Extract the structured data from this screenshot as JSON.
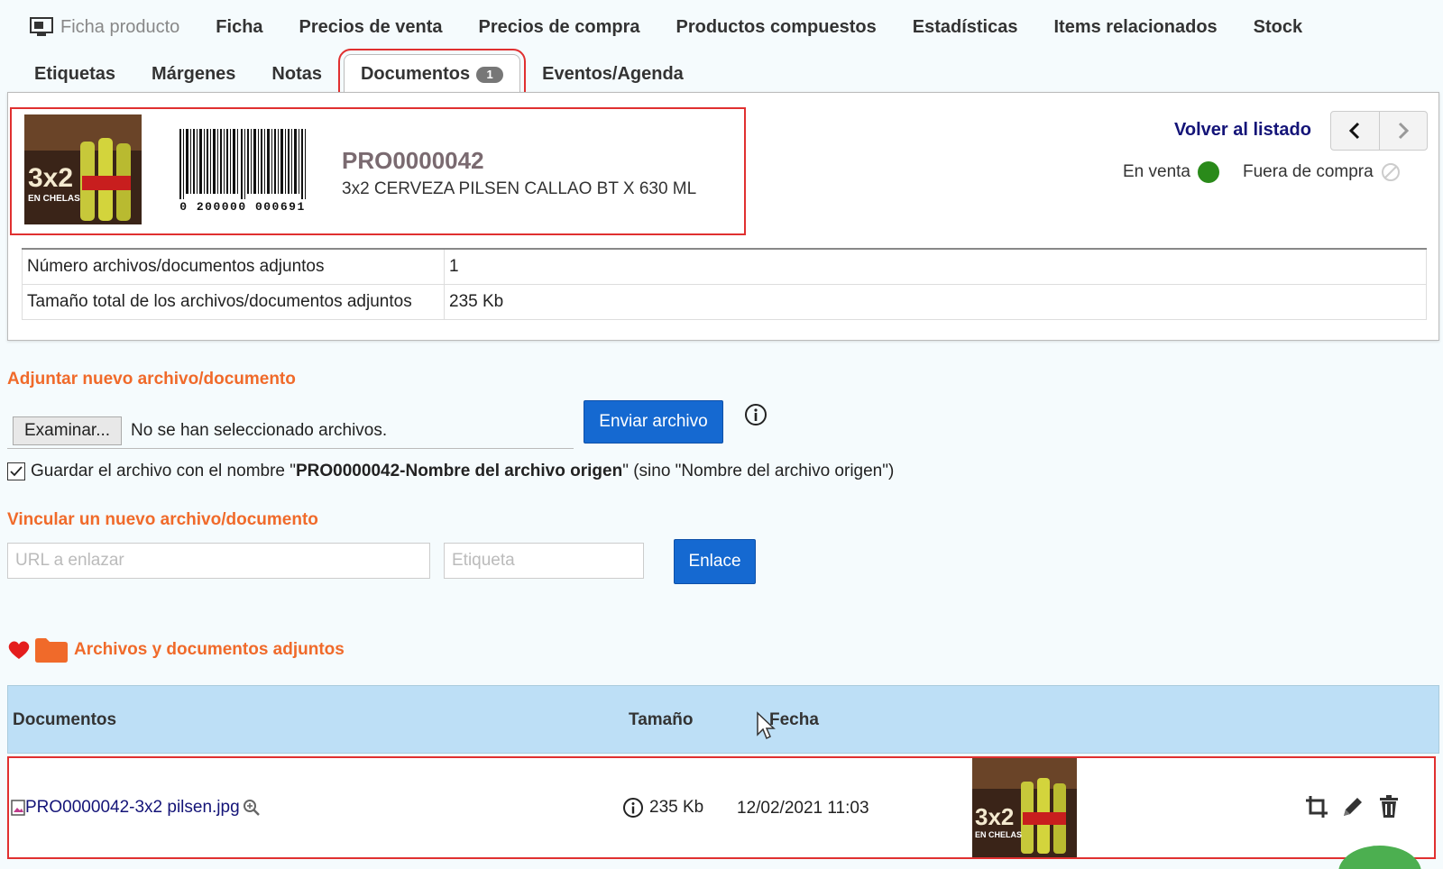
{
  "tabs": {
    "row1": [
      {
        "label": "Ficha producto"
      },
      {
        "label": "Ficha"
      },
      {
        "label": "Precios de venta"
      },
      {
        "label": "Precios de compra"
      },
      {
        "label": "Productos compuestos"
      },
      {
        "label": "Estadísticas"
      },
      {
        "label": "Items relacionados"
      },
      {
        "label": "Stock"
      }
    ],
    "row2": [
      {
        "label": "Etiquetas"
      },
      {
        "label": "Márgenes"
      },
      {
        "label": "Notas"
      },
      {
        "label": "Documentos",
        "badge": "1"
      },
      {
        "label": "Eventos/Agenda"
      }
    ]
  },
  "product": {
    "code": "PRO0000042",
    "name": "3x2 CERVEZA PILSEN CALLAO BT X 630 ML",
    "barcode_text": "0 200000 000691",
    "thumb_text": "3x2",
    "thumb_sub": "EN CHELAS"
  },
  "nav": {
    "back_label": "Volver al listado",
    "status_on_sale": "En venta",
    "status_out_purchase": "Fuera de compra"
  },
  "info": {
    "rows": [
      {
        "label": "Número archivos/documentos adjuntos",
        "value": "1"
      },
      {
        "label": "Tamaño total de los archivos/documentos adjuntos",
        "value": "235 Kb"
      }
    ]
  },
  "upload": {
    "title": "Adjuntar nuevo archivo/documento",
    "browse_label": "Examinar...",
    "no_file_text": "No se han seleccionado archivos.",
    "send_label": "Enviar archivo",
    "checkbox_prefix": "Guardar el archivo con el nombre \"",
    "checkbox_bold": "PRO0000042-Nombre del archivo origen",
    "checkbox_suffix": "\" (sino \"Nombre del archivo origen\")"
  },
  "link": {
    "title": "Vincular un nuevo archivo/documento",
    "url_placeholder": "URL a enlazar",
    "label_placeholder": "Etiqueta",
    "button_label": "Enlace"
  },
  "attachments": {
    "title": "Archivos y documentos adjuntos",
    "columns": {
      "docs": "Documentos",
      "size": "Tamaño",
      "date": "Fecha"
    },
    "rows": [
      {
        "name": "PRO0000042-3x2 pilsen.jpg",
        "size": "235 Kb",
        "date": "12/02/2021 11:03"
      }
    ]
  },
  "colors": {
    "accent_orange": "#f06a2a",
    "link_navy": "#141478",
    "button_blue": "#1569d1",
    "header_blue": "#bddff6",
    "highlight_red": "#e03030",
    "status_green": "#2a8a1a"
  }
}
